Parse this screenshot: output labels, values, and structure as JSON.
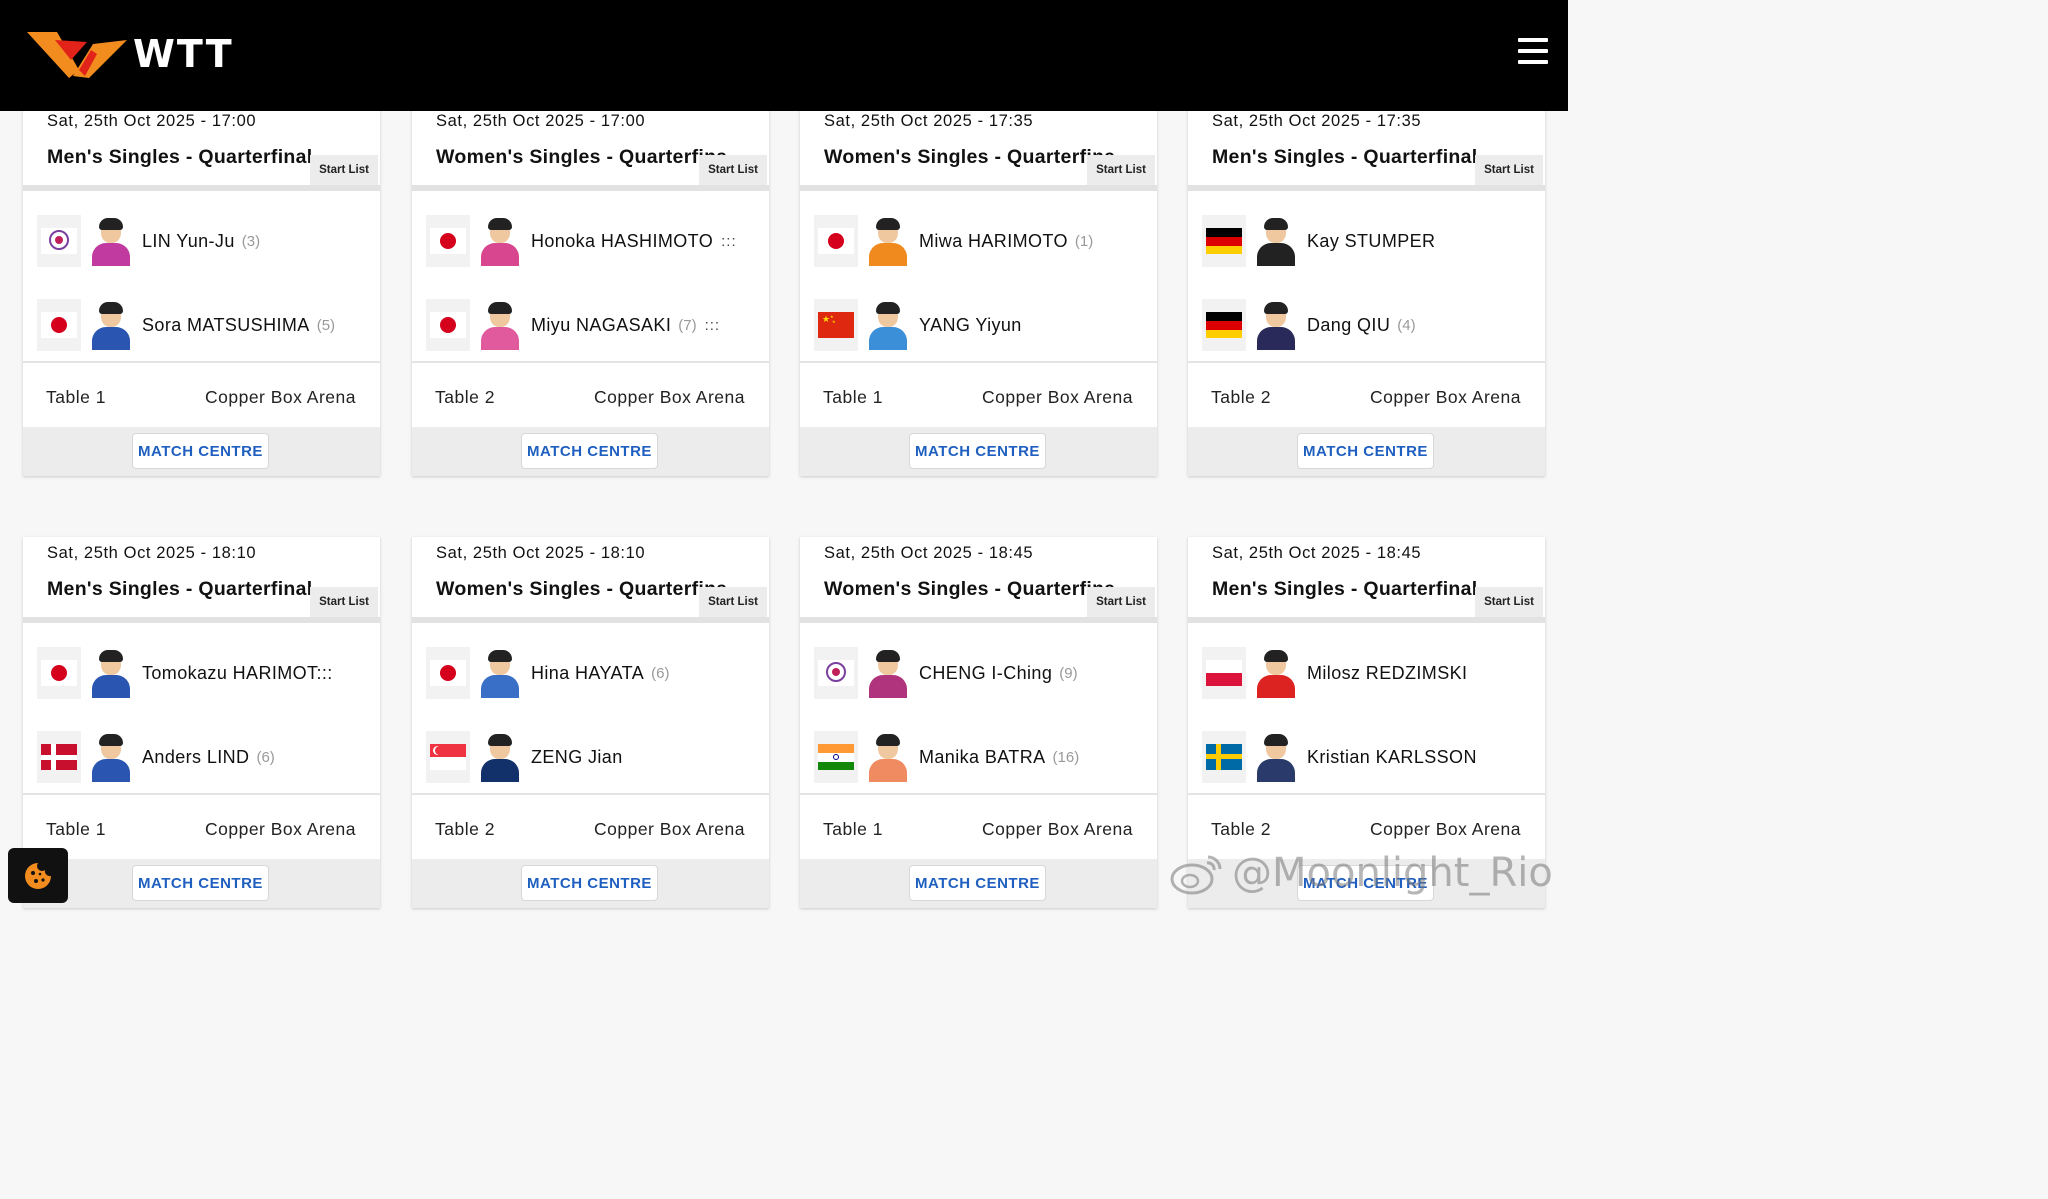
{
  "header": {
    "brand": "WTT"
  },
  "matches": [
    {
      "date": "Sat, 25th Oct 2025 - 17:00",
      "event": "Men's Singles - Quarterfinal",
      "start_list": "Start List",
      "players": [
        {
          "name": "LIN Yun-Ju",
          "seed": "(3)",
          "flag": "tpe",
          "extra": ""
        },
        {
          "name": "Sora MATSUSHIMA",
          "seed": "(5)",
          "flag": "jpn",
          "extra": ""
        }
      ],
      "table": "Table 1",
      "venue": "Copper Box Arena",
      "button": "MATCH CENTRE"
    },
    {
      "date": "Sat, 25th Oct 2025 - 17:00",
      "event": "Women's Singles - Quarterfinal",
      "start_list": "Start List",
      "players": [
        {
          "name": "Honoka HASHIMOTO",
          "seed": "",
          "flag": "jpn",
          "extra": ":::"
        },
        {
          "name": "Miyu NAGASAKI",
          "seed": "(7)",
          "flag": "jpn",
          "extra": ":::"
        }
      ],
      "table": "Table 2",
      "venue": "Copper Box Arena",
      "button": "MATCH CENTRE"
    },
    {
      "date": "Sat, 25th Oct 2025 - 17:35",
      "event": "Women's Singles - Quarterfinal",
      "start_list": "Start List",
      "players": [
        {
          "name": "Miwa HARIMOTO",
          "seed": "(1)",
          "flag": "jpn",
          "extra": ""
        },
        {
          "name": "YANG Yiyun",
          "seed": "",
          "flag": "chn",
          "extra": ""
        }
      ],
      "table": "Table 1",
      "venue": "Copper Box Arena",
      "button": "MATCH CENTRE"
    },
    {
      "date": "Sat, 25th Oct 2025 - 17:35",
      "event": "Men's Singles - Quarterfinal",
      "start_list": "Start List",
      "players": [
        {
          "name": "Kay STUMPER",
          "seed": "",
          "flag": "ger",
          "extra": ""
        },
        {
          "name": "Dang QIU",
          "seed": "(4)",
          "flag": "ger",
          "extra": ""
        }
      ],
      "table": "Table 2",
      "venue": "Copper Box Arena",
      "button": "MATCH CENTRE"
    },
    {
      "date": "Sat, 25th Oct 2025 - 18:10",
      "event": "Men's Singles - Quarterfinal",
      "start_list": "Start List",
      "players": [
        {
          "name": "Tomokazu HARIMOT:::",
          "seed": "",
          "flag": "jpn",
          "extra": ""
        },
        {
          "name": "Anders LIND",
          "seed": "(6)",
          "flag": "den",
          "extra": ""
        }
      ],
      "table": "Table 1",
      "venue": "Copper Box Arena",
      "button": "MATCH CENTRE"
    },
    {
      "date": "Sat, 25th Oct 2025 - 18:10",
      "event": "Women's Singles - Quarterfinal",
      "start_list": "Start List",
      "players": [
        {
          "name": "Hina HAYATA",
          "seed": "(6)",
          "flag": "jpn",
          "extra": ""
        },
        {
          "name": "ZENG Jian",
          "seed": "",
          "flag": "sgp",
          "extra": ""
        }
      ],
      "table": "Table 2",
      "venue": "Copper Box Arena",
      "button": "MATCH CENTRE"
    },
    {
      "date": "Sat, 25th Oct 2025 - 18:45",
      "event": "Women's Singles - Quarterfinal",
      "start_list": "Start List",
      "players": [
        {
          "name": "CHENG I-Ching",
          "seed": "(9)",
          "flag": "tpe",
          "extra": ""
        },
        {
          "name": "Manika BATRA",
          "seed": "(16)",
          "flag": "ind",
          "extra": ""
        }
      ],
      "table": "Table 1",
      "venue": "Copper Box Arena",
      "button": "MATCH CENTRE"
    },
    {
      "date": "Sat, 25th Oct 2025 - 18:45",
      "event": "Men's Singles - Quarterfinal",
      "start_list": "Start List",
      "players": [
        {
          "name": "Milosz REDZIMSKI",
          "seed": "",
          "flag": "pol",
          "extra": ""
        },
        {
          "name": "Kristian KARLSSON",
          "seed": "",
          "flag": "swe",
          "extra": ""
        }
      ],
      "table": "Table 2",
      "venue": "Copper Box Arena",
      "button": "MATCH CENTRE"
    }
  ],
  "watermark": "@Moonlight_Rio",
  "colors": {
    "header_bg": "#000000",
    "accent_orange": "#f28c1e",
    "accent_red": "#e2231a",
    "link_blue": "#1f5fc0"
  },
  "icons": {
    "menu": "hamburger-icon",
    "cookie": "cookie-icon",
    "logo": "wtt-logo"
  }
}
